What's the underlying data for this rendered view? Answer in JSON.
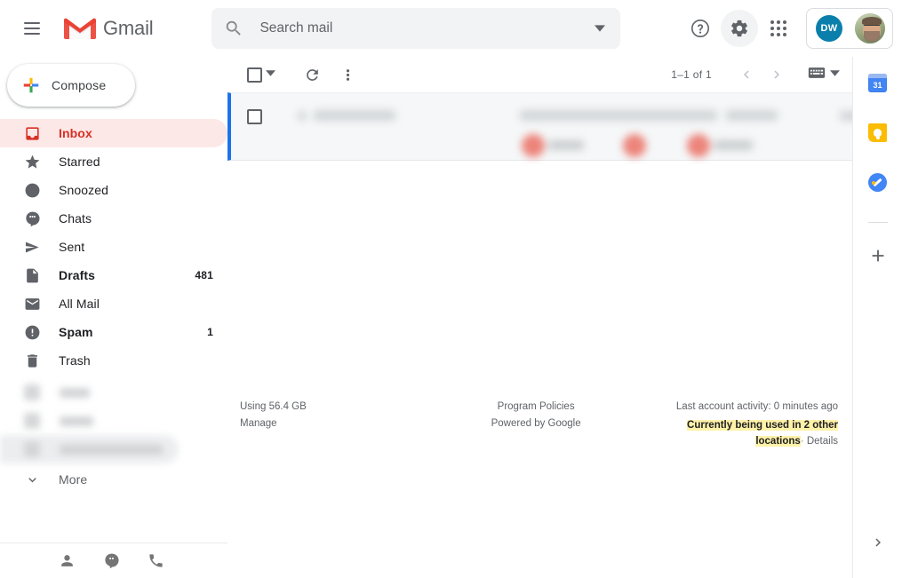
{
  "header": {
    "menu_icon": "hamburger-menu-icon",
    "brand": "Gmail",
    "brand_logo": "gmail-logo-icon",
    "help_icon": "help-icon",
    "settings_icon": "gear-icon",
    "apps_icon": "apps-grid-icon",
    "account_initials": "DW",
    "avatar": "profile-avatar"
  },
  "search": {
    "placeholder": "Search mail",
    "value": "",
    "icon": "search-icon",
    "options_icon": "chevron-down-icon"
  },
  "sidebar": {
    "compose_label": "Compose",
    "compose_icon": "plus-icon",
    "items": [
      {
        "label": "Inbox",
        "icon": "inbox-icon",
        "count": "",
        "selected": true,
        "bold": true
      },
      {
        "label": "Starred",
        "icon": "star-icon",
        "count": "",
        "selected": false,
        "bold": false
      },
      {
        "label": "Snoozed",
        "icon": "clock-icon",
        "count": "",
        "selected": false,
        "bold": false
      },
      {
        "label": "Chats",
        "icon": "chat-icon",
        "count": "",
        "selected": false,
        "bold": false
      },
      {
        "label": "Sent",
        "icon": "send-icon",
        "count": "",
        "selected": false,
        "bold": false
      },
      {
        "label": "Drafts",
        "icon": "draft-icon",
        "count": "481",
        "selected": false,
        "bold": true
      },
      {
        "label": "All Mail",
        "icon": "envelope-icon",
        "count": "",
        "selected": false,
        "bold": false
      },
      {
        "label": "Spam",
        "icon": "spam-icon",
        "count": "1",
        "selected": false,
        "bold": true
      },
      {
        "label": "Trash",
        "icon": "trash-icon",
        "count": "",
        "selected": false,
        "bold": false
      }
    ],
    "redacted_label_rows": 3,
    "more_label": "More",
    "more_icon": "chevron-down-icon",
    "footer_icons": [
      "contacts-icon",
      "hangouts-icon",
      "phone-icon"
    ]
  },
  "toolbar": {
    "select_all_icon": "checkbox-icon",
    "select_all_caret": "chevron-down-icon",
    "refresh_icon": "refresh-icon",
    "more_icon": "more-vertical-icon",
    "range": "1–1 of 1",
    "prev_icon": "chevron-left-icon",
    "next_icon": "chevron-right-icon",
    "input_tools_icon": "keyboard-icon",
    "input_tools_caret": "chevron-down-icon"
  },
  "mail_list": {
    "rows": [
      {
        "redacted": true,
        "selected": true,
        "checkbox_icon": "checkbox-icon",
        "chips": 3
      }
    ]
  },
  "info_footer": {
    "storage": "Using 56.4 GB",
    "manage": "Manage",
    "policies": "Program Policies",
    "powered": "Powered by Google",
    "activity": "Last account activity: 0 minutes ago",
    "used_highlight": "Currently being used in 2 other locations",
    "separator": "·",
    "details": "Details"
  },
  "rail": {
    "items": [
      {
        "name": "google-calendar-icon",
        "day": "31"
      },
      {
        "name": "google-keep-icon"
      },
      {
        "name": "google-tasks-icon"
      }
    ],
    "add_icon": "plus-icon",
    "expand_icon": "chevron-right-icon"
  },
  "colors": {
    "accent_red": "#d93025",
    "selected_bg": "#fce8e6",
    "row_selected_border": "#1a73e8",
    "highlight_yellow": "#fff2a8",
    "chip_red": "#ea6a5e",
    "dw_badge": "#0b7fab"
  }
}
